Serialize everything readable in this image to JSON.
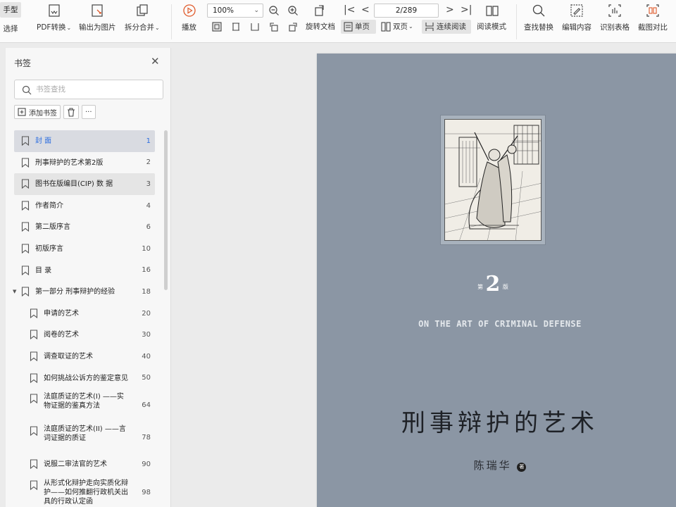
{
  "toolbar": {
    "mode_hand": "手型",
    "mode_select": "选择",
    "pdf_convert": "PDF转换",
    "export_image": "输出为图片",
    "split_merge": "拆分合并",
    "play": "播放",
    "zoom": "100%",
    "page_indicator": "2/289",
    "rotate_doc": "旋转文档",
    "single_page": "单页",
    "double_page": "双页",
    "continuous_read": "连续阅读",
    "read_mode": "阅读模式",
    "find_replace": "查找替换",
    "edit_content": "编辑内容",
    "recognize_table": "识别表格",
    "screenshot_compare": "截图对比"
  },
  "sidebar": {
    "title": "书签",
    "close_icon": "close-icon",
    "search_placeholder": "书签查找",
    "add_bookmark": "添加书签",
    "more": "···",
    "items": [
      {
        "label": "封 面",
        "page": "1",
        "level": 0,
        "state": "selected"
      },
      {
        "label": "刑事辩护的艺术第2版",
        "page": "2",
        "level": 0
      },
      {
        "label": "图书在版编目(CIP) 数 据",
        "page": "3",
        "level": 0,
        "state": "hovered"
      },
      {
        "label": "作者简介",
        "page": "4",
        "level": 0
      },
      {
        "label": "第二版序言",
        "page": "6",
        "level": 0
      },
      {
        "label": "初版序言",
        "page": "10",
        "level": 0
      },
      {
        "label": "目 录",
        "page": "16",
        "level": 0
      },
      {
        "label": "第一部分 刑事辩护的经验",
        "page": "18",
        "level": 0,
        "expanded": true
      },
      {
        "label": "申请的艺术",
        "page": "20",
        "level": 1
      },
      {
        "label": "阅卷的艺术",
        "page": "30",
        "level": 1
      },
      {
        "label": "调查取证的艺术",
        "page": "40",
        "level": 1
      },
      {
        "label": "如何挑战公诉方的鉴定意见",
        "page": "50",
        "level": 1
      },
      {
        "label": "法庭质证的艺术(I) ——实",
        "label2": "物证据的鉴真方法",
        "page": "64",
        "level": 1
      },
      {
        "label": "法庭质证的艺术(II) ——言",
        "label2": "词证据的质证",
        "page": "78",
        "level": 1
      },
      {
        "label": "说服二审法官的艺术",
        "page": "90",
        "level": 1
      },
      {
        "label": "从形式化辩护走向实质化辩",
        "label2": "护——如何推翻行政机关出",
        "label3": "具的行政认定函",
        "page": "98",
        "level": 1
      }
    ]
  },
  "document": {
    "edition_prefix": "第",
    "edition_number": "2",
    "edition_suffix": "版",
    "english_title": "ON THE ART OF CRIMINAL DEFENSE",
    "chinese_title": "刑事辩护的艺术",
    "author": "陈瑞华",
    "author_mark": "著",
    "cover_color": "#8b96a4"
  }
}
